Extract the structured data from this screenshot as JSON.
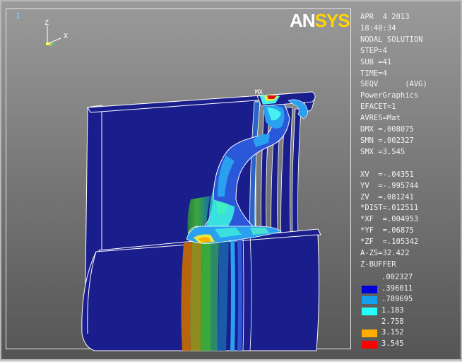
{
  "window_number": "1",
  "triad": {
    "z_label": "Z",
    "x_label": "X",
    "y_label": "Y"
  },
  "logo": {
    "part1": "AN",
    "part2": "SYS"
  },
  "info_lines": [
    "APR  4 2013",
    "18:40:34",
    "NODAL SOLUTION",
    "STEP=4",
    "SUB =41",
    "TIME=4",
    "SEQV      (AVG)",
    "PowerGraphics",
    "EFACET=1",
    "AVRES=Mat",
    "DMX =.008075",
    "SMN =.002327",
    "SMX =3.545",
    "",
    "XV  =-.04351",
    "YV  =-.995744",
    "ZV  =.081241",
    "*DIST=.012511",
    "*XF  =.004953",
    "*YF  =.06875",
    "*ZF  =.105342",
    "A-ZS=32.422",
    "Z-BUFFER"
  ],
  "legend": [
    {
      "value": ".002327",
      "color": ""
    },
    {
      "value": ".396011",
      "color": "#0000d8"
    },
    {
      "value": ".789695",
      "color": "#14a0ee"
    },
    {
      "value": "1.183",
      "color": "#25ffff"
    },
    {
      "value": "2.758",
      "color": ""
    },
    {
      "value": "3.152",
      "color": "#ffae00"
    },
    {
      "value": "3.545",
      "color": "#ff0000"
    }
  ],
  "max_marker": "MX",
  "colors": {
    "base_blue": "#1a1e8c",
    "light_blue": "#2aa0f0",
    "cyan": "#40f0f0",
    "green": "#3ca83c",
    "olive": "#9b8a1c",
    "orange": "#c86a10",
    "red": "#e01010"
  }
}
